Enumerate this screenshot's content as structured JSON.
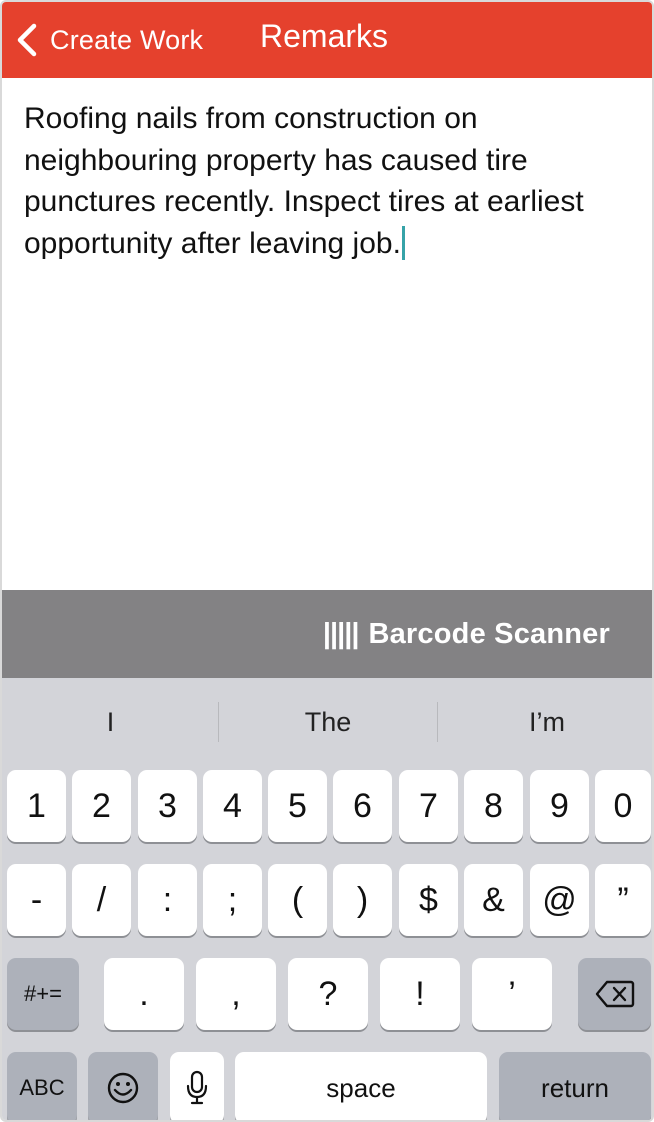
{
  "header": {
    "back_label": "Create Work",
    "title": "Remarks",
    "bg_color": "#e5412d"
  },
  "editor": {
    "text": "Roofing nails from construction on neighbouring property has caused tire punctures recently. Inspect tires at earliest opportunity after leaving job."
  },
  "barcode": {
    "glyph": "|||||",
    "label": "Barcode Scanner"
  },
  "keyboard": {
    "suggestions": [
      "I",
      "The",
      "I’m"
    ],
    "row1": [
      "1",
      "2",
      "3",
      "4",
      "5",
      "6",
      "7",
      "8",
      "9",
      "0"
    ],
    "row2": [
      "-",
      "/",
      ":",
      ";",
      "(",
      ")",
      "$",
      "&",
      "@",
      "”"
    ],
    "row3": [
      "#+=",
      ".",
      ",",
      "?",
      "!",
      "’"
    ],
    "row4": {
      "abc": "ABC",
      "space": "space",
      "return": "return"
    }
  }
}
